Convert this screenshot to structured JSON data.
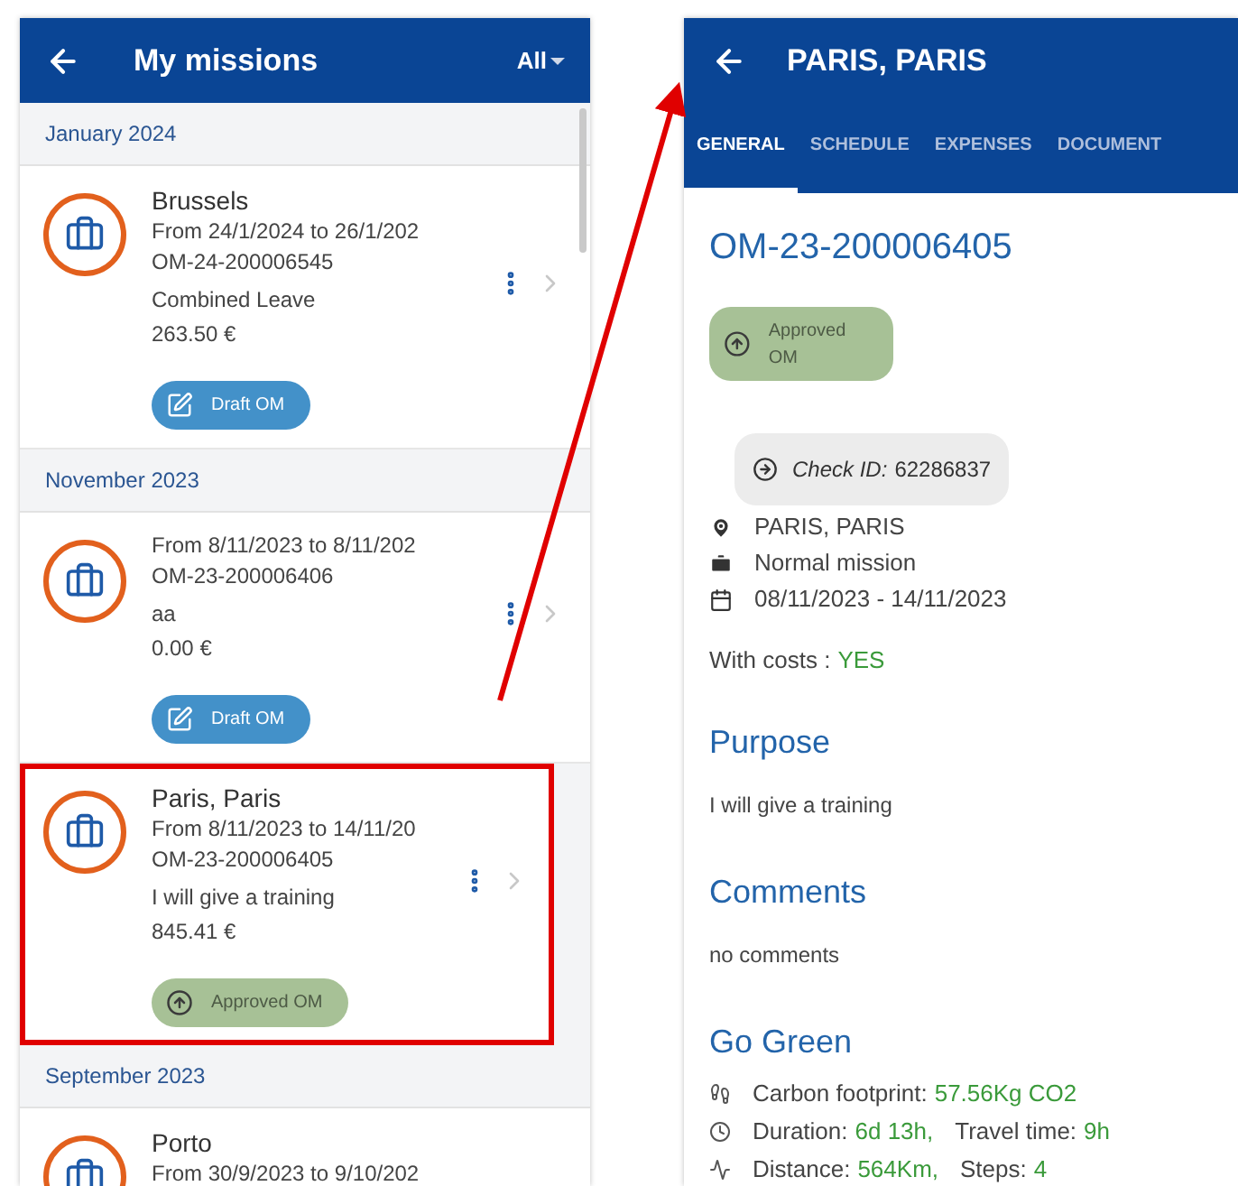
{
  "missions_screen": {
    "title": "My missions",
    "filter": "All",
    "groups": [
      {
        "month": "January 2024",
        "missions": [
          {
            "title": "Brussels",
            "dates": "From 24/1/2024 to 26/1/202",
            "id": "OM-24-200006545",
            "purpose": "Combined Leave",
            "amount": "263.50 €",
            "status": {
              "kind": "draft",
              "label": "Draft OM"
            },
            "highlighted": false
          }
        ]
      },
      {
        "month": "November 2023",
        "missions": [
          {
            "dates": "From 8/11/2023 to 8/11/202",
            "id": "OM-23-200006406",
            "purpose": "aa",
            "amount": "0.00 €",
            "status": {
              "kind": "draft",
              "label": "Draft OM"
            },
            "highlighted": false
          },
          {
            "title": "Paris, Paris",
            "dates": "From 8/11/2023 to 14/11/20",
            "id": "OM-23-200006405",
            "purpose": "I will give a training",
            "amount": "845.41 €",
            "status": {
              "kind": "approved",
              "label": "Approved OM"
            },
            "highlighted": true
          }
        ]
      },
      {
        "month": "September 2023",
        "missions": [
          {
            "title": "Porto",
            "dates": "From 30/9/2023 to 9/10/202",
            "highlighted": false
          }
        ]
      }
    ]
  },
  "detail_screen": {
    "title": "PARIS, PARIS",
    "tabs": [
      {
        "label": "GENERAL",
        "selected": true
      },
      {
        "label": "SCHEDULE",
        "selected": false
      },
      {
        "label": "EXPENSES",
        "selected": false
      },
      {
        "label": "DOCUMENT",
        "selected": false
      }
    ],
    "mission_id": "OM-23-200006405",
    "status": {
      "kind": "approved",
      "label": "Approved OM"
    },
    "check": {
      "label": "Check ID:",
      "value": "62286837"
    },
    "details": [
      {
        "kind": "location",
        "text": "PARIS, PARIS"
      },
      {
        "kind": "type",
        "text": "Normal mission"
      },
      {
        "kind": "dates",
        "text": "08/11/2023 - 14/11/2023"
      }
    ],
    "costs": {
      "label": "With costs :",
      "value": "YES"
    },
    "purpose": {
      "title": "Purpose",
      "text": "I will give a training"
    },
    "comments": {
      "title": "Comments",
      "text": "no comments"
    },
    "go_green": {
      "title": "Go Green",
      "rows": [
        {
          "kind": "carbon",
          "parts": [
            {
              "label": "Carbon footprint:",
              "value": "57.56Kg CO2"
            }
          ]
        },
        {
          "kind": "time",
          "parts": [
            {
              "label": "Duration:",
              "value": "6d 13h,"
            },
            {
              "label": "Travel time:",
              "value": "9h"
            }
          ]
        },
        {
          "kind": "distance",
          "parts": [
            {
              "label": "Distance:",
              "value": "564Km,"
            },
            {
              "label": "Steps:",
              "value": "4"
            }
          ]
        }
      ]
    }
  }
}
